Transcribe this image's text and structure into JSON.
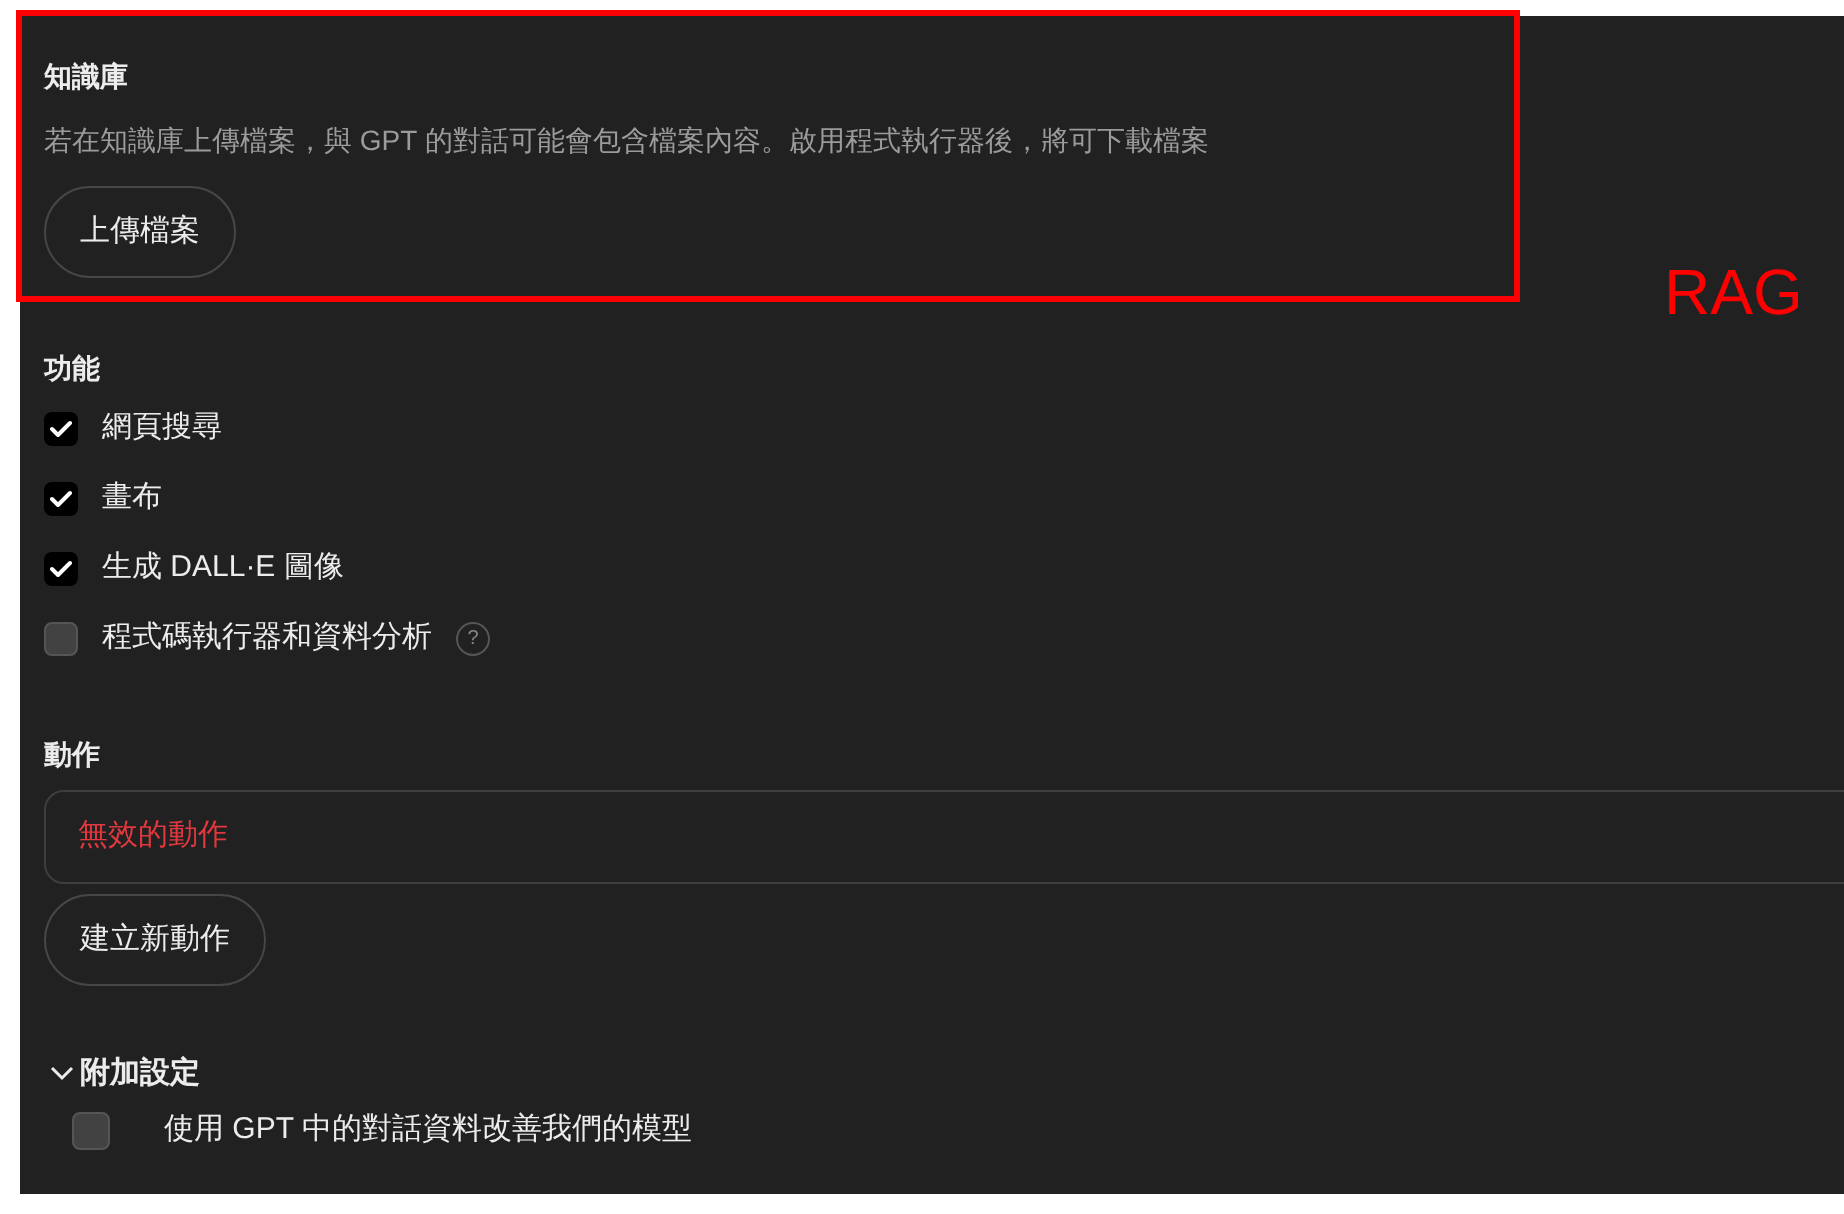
{
  "knowledge": {
    "title": "知識庫",
    "description": "若在知識庫上傳檔案，與 GPT 的對話可能會包含檔案內容。啟用程式執行器後，將可下載檔案",
    "upload_button": "上傳檔案"
  },
  "annotation": {
    "label": "RAG"
  },
  "capabilities": {
    "title": "功能",
    "items": [
      {
        "label": "網頁搜尋",
        "checked": true
      },
      {
        "label": "畫布",
        "checked": true
      },
      {
        "label": "生成 DALL·E 圖像",
        "checked": true
      },
      {
        "label": "程式碼執行器和資料分析",
        "checked": false,
        "help": "?"
      }
    ]
  },
  "actions": {
    "title": "動作",
    "items": [
      {
        "label": "無效的動作",
        "invalid": true
      }
    ],
    "create_button": "建立新動作"
  },
  "additional_settings": {
    "title": "附加設定",
    "expanded": true,
    "items": [
      {
        "label": "使用 GPT 中的對話資料改善我們的模型",
        "checked": false
      }
    ]
  }
}
